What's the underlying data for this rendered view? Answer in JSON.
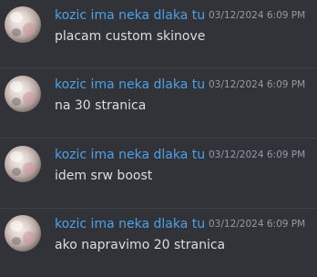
{
  "messages": [
    {
      "username": "kozic ima neka dlaka tu",
      "timestamp": "03/12/2024 6:09 PM",
      "content": "placam custom skinove"
    },
    {
      "username": "kozic ima neka dlaka tu",
      "timestamp": "03/12/2024 6:09 PM",
      "content": "na 30 stranica"
    },
    {
      "username": "kozic ima neka dlaka tu",
      "timestamp": "03/12/2024 6:09 PM",
      "content": "idem srw boost"
    },
    {
      "username": "kozic ima neka dlaka tu",
      "timestamp": "03/12/2024 6:09 PM",
      "content": "ako napravimo 20 stranica"
    }
  ],
  "colors": {
    "background": "#313338",
    "username": "#4fa0e4",
    "timestamp": "#949ba4",
    "message_text": "#dbdee1",
    "divider": "#3f4147"
  }
}
